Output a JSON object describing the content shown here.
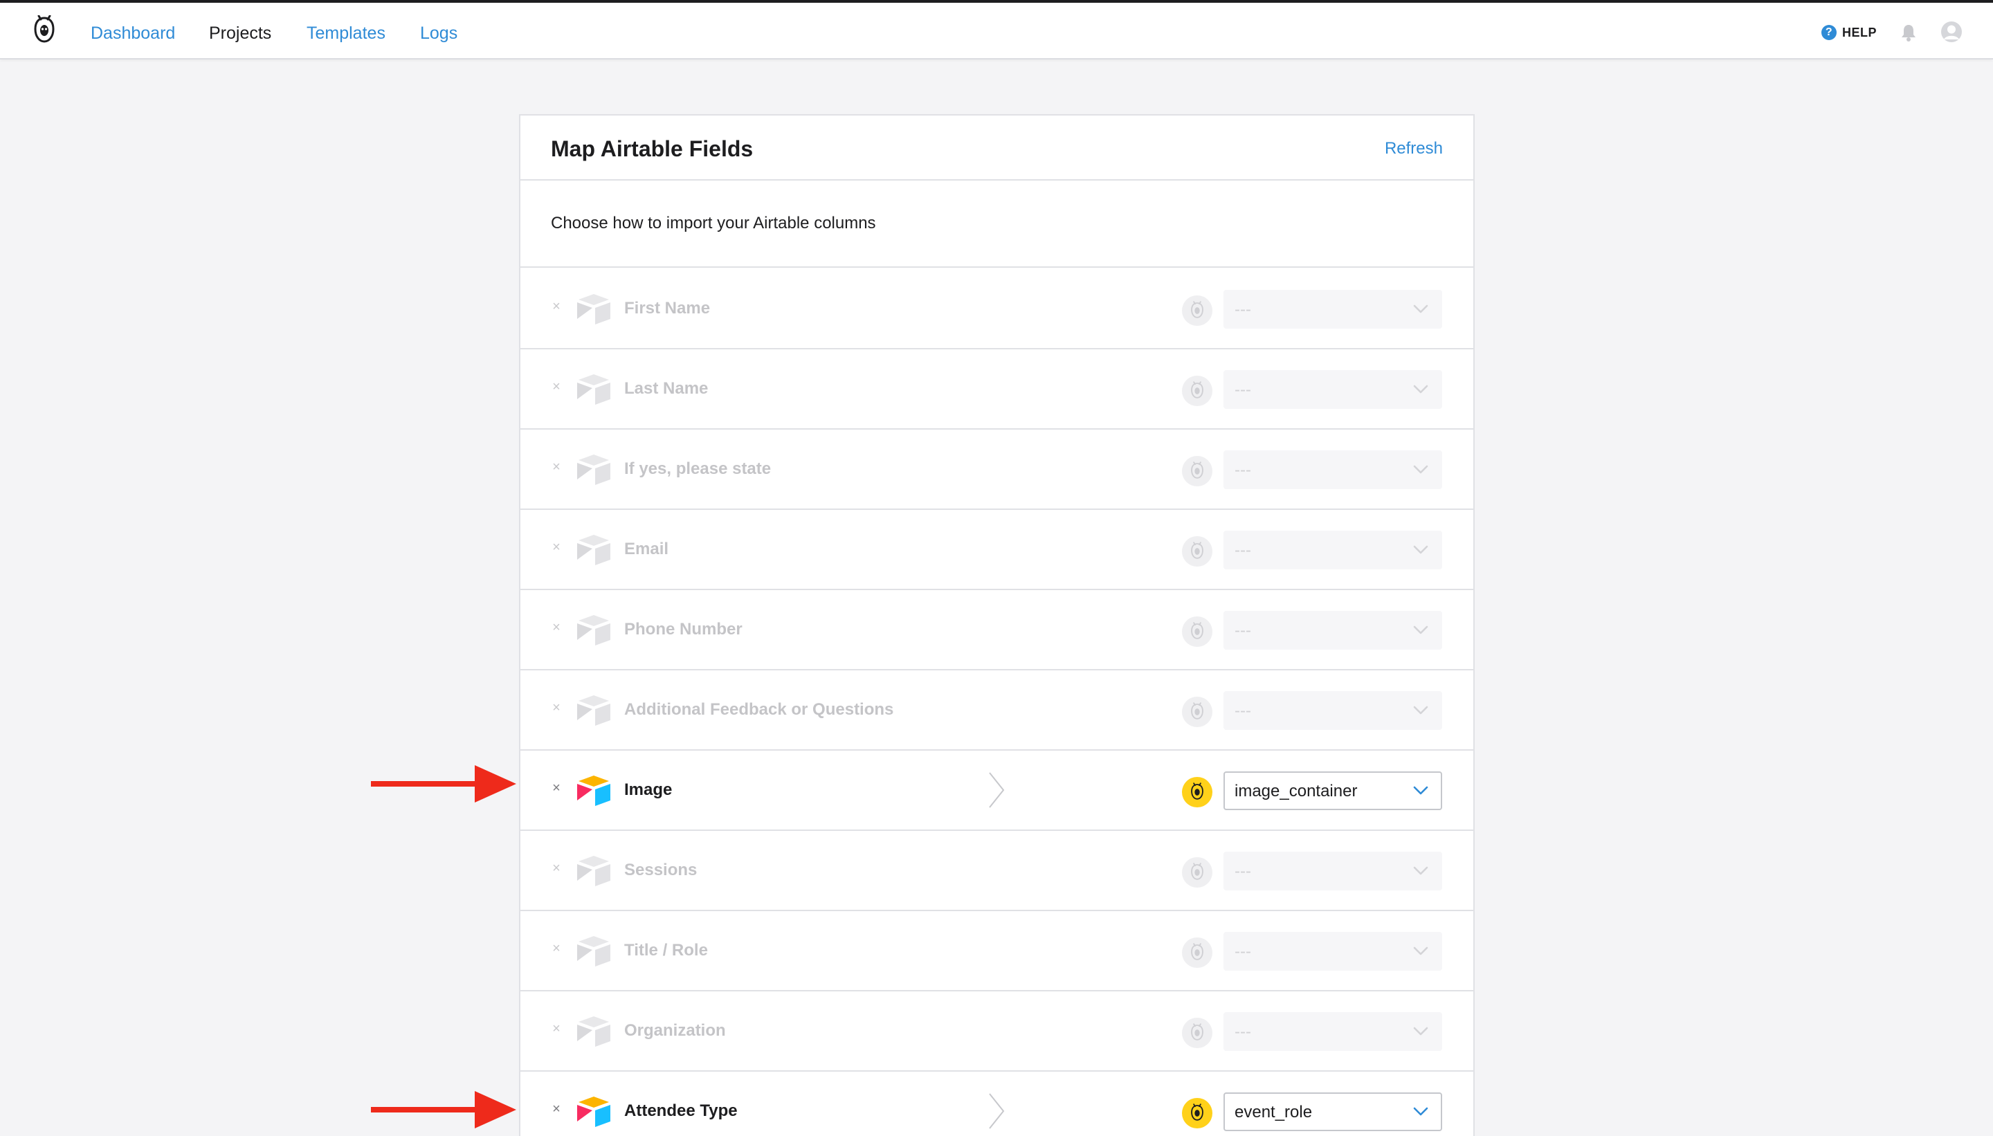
{
  "nav": {
    "links": [
      {
        "label": "Dashboard",
        "active": false
      },
      {
        "label": "Projects",
        "active": true
      },
      {
        "label": "Templates",
        "active": false
      },
      {
        "label": "Logs",
        "active": false
      }
    ],
    "help_label": "HELP",
    "help_glyph": "?"
  },
  "card": {
    "title": "Map Airtable Fields",
    "refresh_label": "Refresh",
    "subtitle": "Choose how to import your Airtable columns"
  },
  "rows": [
    {
      "field": "First Name",
      "value": "---",
      "mapped": false
    },
    {
      "field": "Last Name",
      "value": "---",
      "mapped": false
    },
    {
      "field": "If yes, please state",
      "value": "---",
      "mapped": false
    },
    {
      "field": "Email",
      "value": "---",
      "mapped": false
    },
    {
      "field": "Phone Number",
      "value": "---",
      "mapped": false
    },
    {
      "field": "Additional Feedback or Questions",
      "value": "---",
      "mapped": false
    },
    {
      "field": "Image",
      "value": "image_container",
      "mapped": true
    },
    {
      "field": "Sessions",
      "value": "---",
      "mapped": false
    },
    {
      "field": "Title / Role",
      "value": "---",
      "mapped": false
    },
    {
      "field": "Organization",
      "value": "---",
      "mapped": false
    },
    {
      "field": "Attendee Type",
      "value": "event_role",
      "mapped": true
    }
  ],
  "icons": {
    "remove": "close-icon",
    "source": "airtable-cube-icon",
    "target": "app-logo-badge-icon",
    "caret": "chevron-down-icon",
    "connector": "chevron-right-icon"
  },
  "colors": {
    "link": "#2f8bd6",
    "badge_active": "#ffd11a",
    "arrow": "#ee2a1b",
    "airtable_yellow": "#fcb400",
    "airtable_blue": "#18bfff",
    "airtable_red": "#f82b60"
  }
}
